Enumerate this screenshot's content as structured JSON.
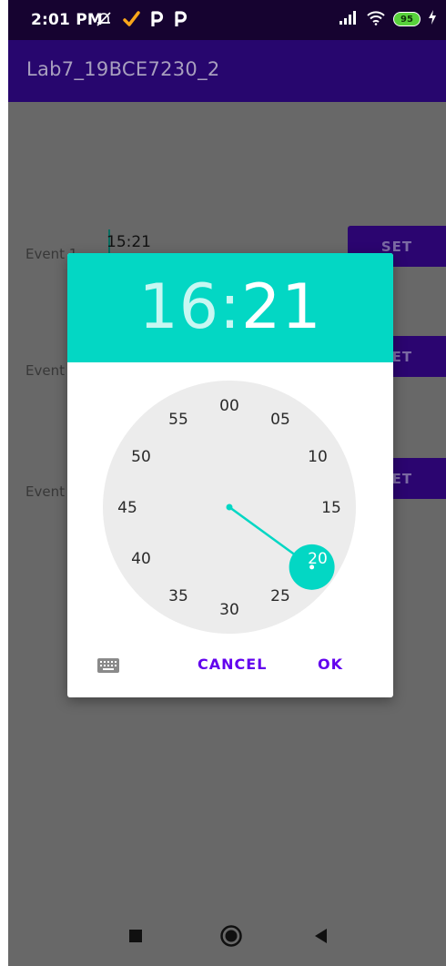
{
  "status_bar": {
    "time": "2:01 PM",
    "battery": "95",
    "icons": [
      "muted-bell-icon",
      "check-icon",
      "parking-icon",
      "parking-icon",
      "signal-icon",
      "wifi-icon",
      "battery-icon",
      "charging-icon"
    ]
  },
  "app_bar": {
    "title": "Lab7_19BCE7230_2"
  },
  "events": [
    {
      "label": "Event 1",
      "time": "15:21",
      "set_label": "SET"
    },
    {
      "label": "Event",
      "time": "",
      "set_label": "SET"
    },
    {
      "label": "Event",
      "time": "",
      "set_label": "SET"
    }
  ],
  "dialog": {
    "hour": "16",
    "separator": ":",
    "minute": "21",
    "selected_minute": 21,
    "clock_labels": [
      "00",
      "05",
      "10",
      "15",
      "20",
      "25",
      "30",
      "35",
      "40",
      "45",
      "50",
      "55"
    ],
    "cancel_label": "CANCEL",
    "ok_label": "OK"
  },
  "colors": {
    "accent": "#03d7c4",
    "primary": "#6200ee",
    "app_bar": "#27066e",
    "status_bar": "#160330",
    "clock_face": "#ececec"
  }
}
